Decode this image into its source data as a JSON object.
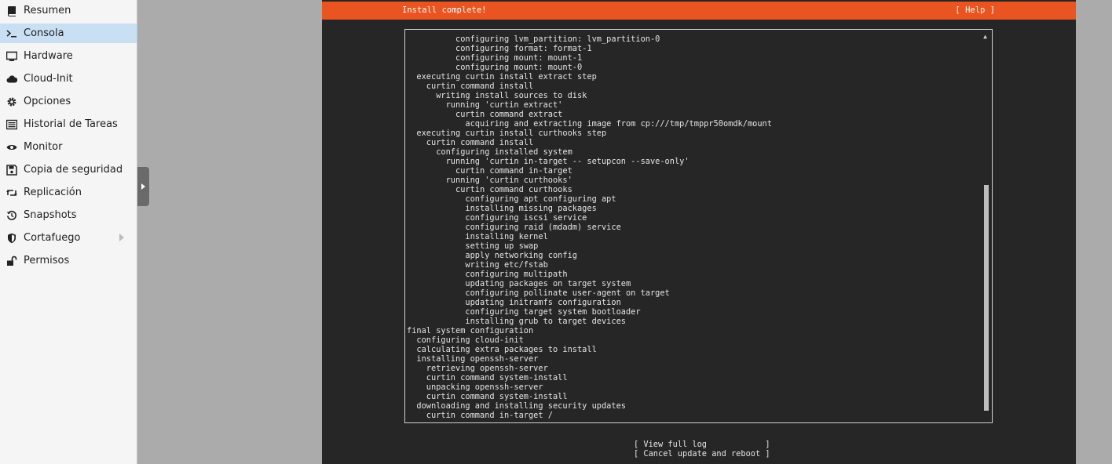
{
  "sidebar": {
    "items": [
      {
        "label": "Resumen",
        "icon": "book-icon"
      },
      {
        "label": "Consola",
        "icon": "terminal-icon",
        "active": true
      },
      {
        "label": "Hardware",
        "icon": "monitor-icon"
      },
      {
        "label": "Cloud-Init",
        "icon": "cloud-icon"
      },
      {
        "label": "Opciones",
        "icon": "gear-icon"
      },
      {
        "label": "Historial de Tareas",
        "icon": "list-icon"
      },
      {
        "label": "Monitor",
        "icon": "eye-icon"
      },
      {
        "label": "Copia de seguridad",
        "icon": "floppy-icon"
      },
      {
        "label": "Replicación",
        "icon": "retweet-icon"
      },
      {
        "label": "Snapshots",
        "icon": "history-icon"
      },
      {
        "label": "Cortafuego",
        "icon": "shield-icon",
        "has_submenu": true
      },
      {
        "label": "Permisos",
        "icon": "unlock-icon"
      }
    ]
  },
  "console": {
    "header": {
      "title": "Install complete!",
      "help": "[ Help ]"
    },
    "log": [
      "          configuring lvm_partition: lvm_partition-0",
      "          configuring format: format-1",
      "          configuring mount: mount-1",
      "          configuring mount: mount-0",
      "  executing curtin install extract step",
      "    curtin command install",
      "      writing install sources to disk",
      "        running 'curtin extract'",
      "          curtin command extract",
      "            acquiring and extracting image from cp:///tmp/tmppr50omdk/mount",
      "  executing curtin install curthooks step",
      "    curtin command install",
      "      configuring installed system",
      "        running 'curtin in-target -- setupcon --save-only'",
      "          curtin command in-target",
      "        running 'curtin curthooks'",
      "          curtin command curthooks",
      "            configuring apt configuring apt",
      "            installing missing packages",
      "            configuring iscsi service",
      "            configuring raid (mdadm) service",
      "            installing kernel",
      "            setting up swap",
      "            apply networking config",
      "            writing etc/fstab",
      "            configuring multipath",
      "            updating packages on target system",
      "            configuring pollinate user-agent on target",
      "            updating initramfs configuration",
      "            configuring target system bootloader",
      "            installing grub to target devices",
      "final system configuration",
      "  configuring cloud-init",
      "  calculating extra packages to install",
      "  installing openssh-server",
      "    retrieving openssh-server",
      "    curtin command system-install",
      "    unpacking openssh-server",
      "    curtin command system-install",
      "  downloading and installing security updates",
      "    curtin command in-target /"
    ],
    "scroll_up_glyph": "▲",
    "actions": {
      "view_log": "[ View full log            ]",
      "cancel": "[ Cancel update and reboot ]"
    }
  }
}
